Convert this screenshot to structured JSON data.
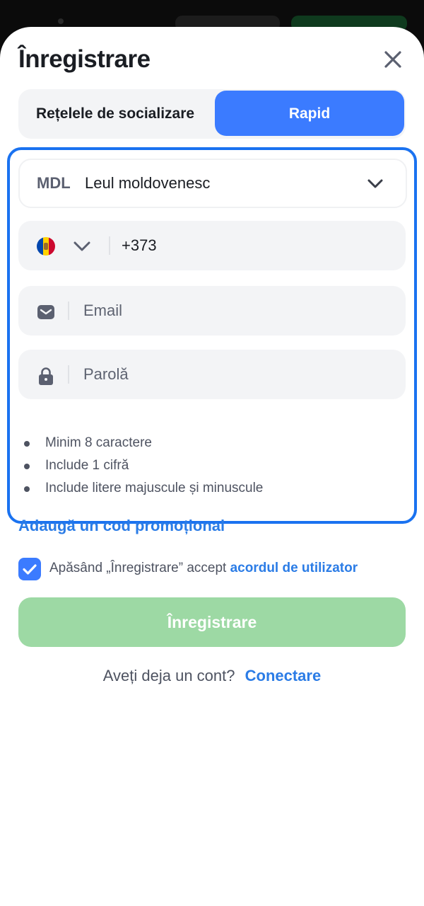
{
  "header": {
    "title": "Înregistrare"
  },
  "tabs": [
    {
      "label": "Rețelele de socializare"
    },
    {
      "label": "Rapid",
      "active": true
    }
  ],
  "form": {
    "currency": {
      "code": "MDL",
      "name": "Leul moldovenesc"
    },
    "phone": {
      "country": "Moldova",
      "value": "+373"
    },
    "email": {
      "placeholder": "Email"
    },
    "password": {
      "placeholder": "Parolă"
    },
    "password_rules": [
      "Minim 8 caractere",
      "Include 1 cifră",
      "Include litere majuscule și minuscule"
    ],
    "promo_link": "Adaugă un cod promoțional"
  },
  "consent": {
    "checked": true,
    "text": "Apăsând „Înregistrare” accept",
    "link": "acordul de utilizator"
  },
  "register_button": "Înregistrare",
  "login": {
    "question": "Aveți deja un cont?",
    "link": "Conectare"
  },
  "colors": {
    "accent": "#3b7bff",
    "link": "#2b7ce6",
    "register_disabled": "#9dd9a4",
    "focus_frame": "#1a72f0"
  },
  "icons": [
    "close-icon",
    "chevron-down-icon",
    "moldova-flag-icon",
    "mail-icon",
    "lock-icon",
    "checkmark-icon"
  ]
}
